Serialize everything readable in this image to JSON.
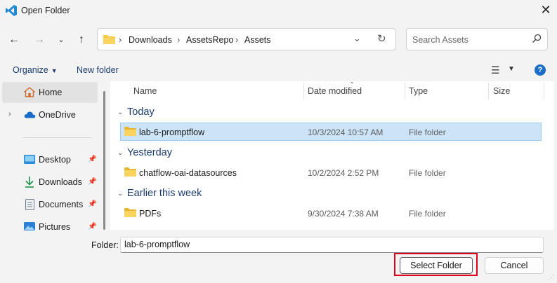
{
  "window": {
    "title": "Open Folder",
    "close_icon": "close-icon",
    "app_icon": "vscode-icon"
  },
  "nav": {
    "back_icon": "arrow-left-icon",
    "forward_icon": "arrow-right-icon",
    "recent_icon": "chevron-down-icon",
    "up_icon": "arrow-up-icon"
  },
  "address": {
    "crumbs": [
      "Downloads",
      "AssetsRepo",
      "Assets"
    ],
    "separator": "›"
  },
  "search": {
    "placeholder": "Search Assets"
  },
  "toolbar": {
    "organize": "Organize",
    "new_folder": "New folder",
    "help": "?"
  },
  "sidebar": {
    "top_items": [
      {
        "label": "Home",
        "icon": "home-icon",
        "selected": true
      },
      {
        "label": "OneDrive",
        "icon": "cloud-icon",
        "expandable": true
      }
    ],
    "quick_access": [
      {
        "label": "Desktop",
        "icon": "desktop-icon",
        "pinned": true
      },
      {
        "label": "Downloads",
        "icon": "download-icon",
        "pinned": true
      },
      {
        "label": "Documents",
        "icon": "document-icon",
        "pinned": true
      },
      {
        "label": "Pictures",
        "icon": "pictures-icon",
        "pinned": true
      }
    ]
  },
  "columns": {
    "name": "Name",
    "date": "Date modified",
    "type": "Type",
    "size": "Size"
  },
  "groups": [
    {
      "label": "Today",
      "files": [
        {
          "name": "lab-6-promptflow",
          "date": "10/3/2024 10:57 AM",
          "type": "File folder",
          "selected": true
        }
      ]
    },
    {
      "label": "Yesterday",
      "files": [
        {
          "name": "chatflow-oai-datasources",
          "date": "10/2/2024 2:52 PM",
          "type": "File folder"
        }
      ]
    },
    {
      "label": "Earlier this week",
      "files": [
        {
          "name": "PDFs",
          "date": "9/30/2024 7:38 AM",
          "type": "File folder"
        }
      ]
    }
  ],
  "footer": {
    "folder_label": "Folder:",
    "folder_value": "lab-6-promptflow",
    "select_label": "Select Folder",
    "cancel_label": "Cancel"
  },
  "colors": {
    "accent": "#1b6fc9",
    "selection": "#cce4f7",
    "highlight_box": "#e0001b",
    "folder": "#f8c945"
  }
}
